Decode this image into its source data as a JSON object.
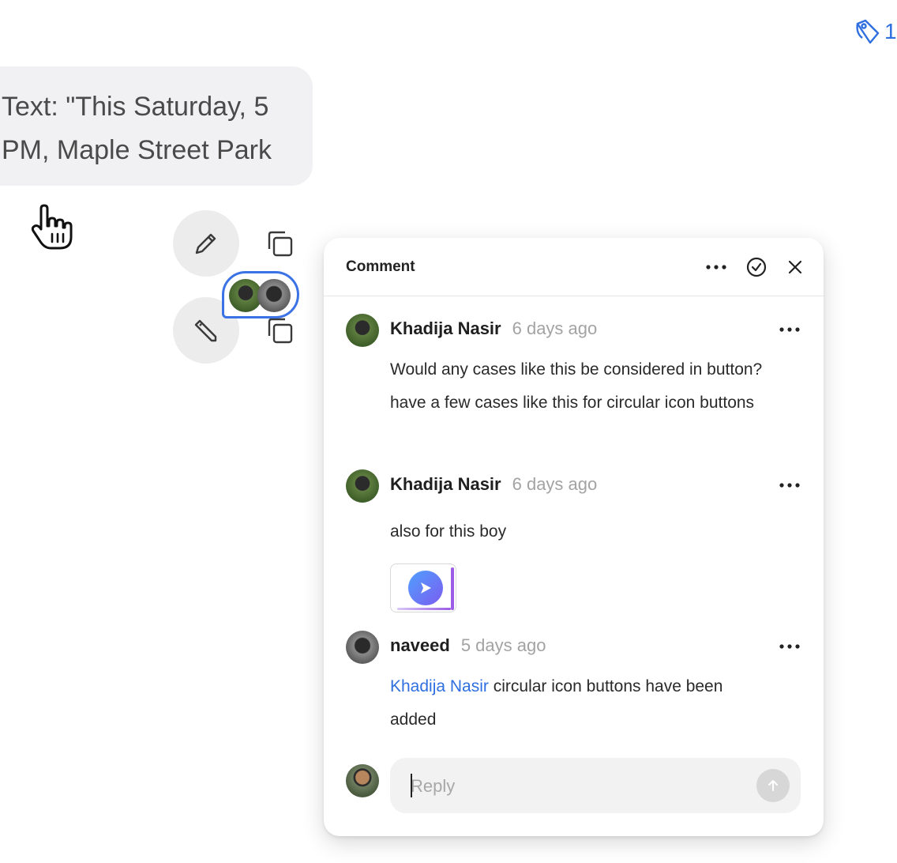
{
  "top_counter": {
    "icon": "tag-icon",
    "value": "1"
  },
  "message": {
    "text": "Text: \"This Saturday, 5\nPM, Maple Street Park"
  },
  "panel": {
    "title": "Comment",
    "comments": [
      {
        "author": "Khadija Nasir",
        "time": "6 days ago",
        "body": "Would any cases like this be considered in button? have a few cases like this for circular icon buttons"
      },
      {
        "author": "Khadija Nasir",
        "time": "6 days ago",
        "body": "also for this boy",
        "attachment": "play-button-thumbnail"
      },
      {
        "author": "naveed",
        "time": "5 days ago",
        "mention": "Khadija Nasir",
        "body": " circular icon buttons have been added"
      }
    ],
    "reply": {
      "placeholder": "Reply"
    }
  },
  "colors": {
    "accent": "#2f6fe0",
    "mention": "#2f6fe0",
    "bubble_bg": "#f1f1f3"
  }
}
